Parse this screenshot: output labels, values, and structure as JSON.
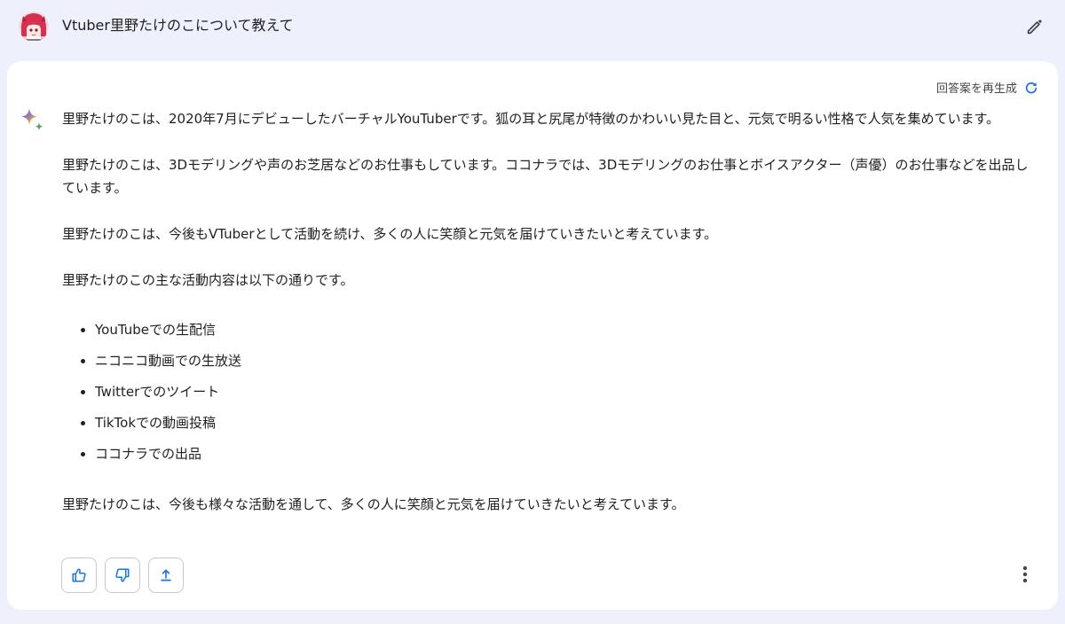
{
  "prompt": {
    "text": "Vtuber里野たけのこについて教えて",
    "avatar_icon": "user-avatar-anime-girl",
    "edit_icon": "pencil-icon"
  },
  "response": {
    "regenerate_label": "回答案を再生成",
    "regenerate_icon": "refresh-icon",
    "assistant_icon": "sparkle-icon",
    "paragraphs_before": [
      "里野たけのこは、2020年7月にデビューしたバーチャルYouTuberです。狐の耳と尻尾が特徴のかわいい見た目と、元気で明るい性格で人気を集めています。",
      "里野たけのこは、3Dモデリングや声のお芝居などのお仕事もしています。ココナラでは、3Dモデリングのお仕事とボイスアクター（声優）のお仕事などを出品しています。",
      "里野たけのこは、今後もVTuberとして活動を続け、多くの人に笑顔と元気を届けていきたいと考えています。",
      "里野たけのこの主な活動内容は以下の通りです。"
    ],
    "list_items": [
      "YouTubeでの生配信",
      "ニコニコ動画での生放送",
      "Twitterでのツイート",
      "TikTokでの動画投稿",
      "ココナラでの出品"
    ],
    "paragraph_after": "里野たけのこは、今後も様々な活動を通して、多くの人に笑顔と元気を届けていきたいと考えています。"
  },
  "actions": {
    "like_icon": "thumbs-up-icon",
    "dislike_icon": "thumbs-down-icon",
    "share_icon": "share-upload-icon",
    "more_icon": "more-vertical-icon"
  },
  "colors": {
    "page_background": "#eef1fb",
    "card_background": "#ffffff",
    "accent_blue": "#1a73e8",
    "button_border": "#c7c9d1"
  }
}
